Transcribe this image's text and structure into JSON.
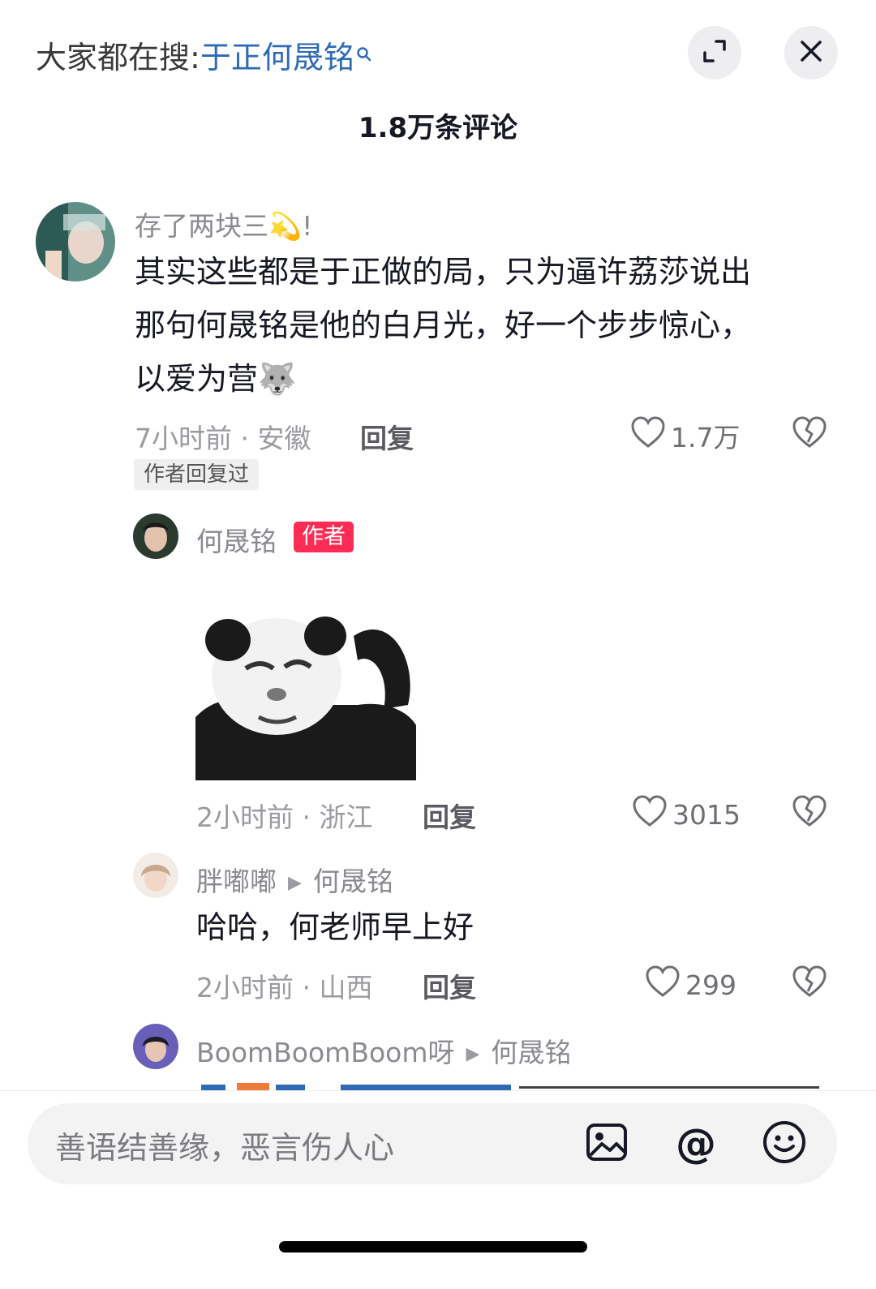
{
  "header": {
    "search_prefix": "大家都在搜:",
    "search_term": "于正何晟铭",
    "comment_count": "1.8万条评论"
  },
  "comments": [
    {
      "username": "存了两块三💫!",
      "text_lines": [
        "其实这些都是于正做的局，只为逼许荔莎说出",
        "那句何晟铭是他的白月光，好一个步步惊心，",
        "以爱为营🐺"
      ],
      "meta": "7小时前 · 安徽",
      "reply_label": "回复",
      "likes": "1.7万",
      "author_replied": "作者回复过"
    },
    {
      "username": "何晟铭",
      "badge": "作者",
      "meta": "2小时前 · 浙江",
      "reply_label": "回复",
      "likes": "3015"
    },
    {
      "username": "胖嘟嘟",
      "reply_to": "何晟铭",
      "text": "哈哈，何老师早上好",
      "meta": "2小时前 · 山西",
      "reply_label": "回复",
      "likes": "299"
    },
    {
      "username": "BoomBoomBoom呀",
      "reply_to": "何晟铭"
    }
  ],
  "input": {
    "placeholder": "善语结善缘，恶言伤人心"
  },
  "colors": {
    "search_term": "#2f6bb5",
    "author_badge": "#fe2c55",
    "text": "#161823",
    "muted": "#9a9aa0"
  }
}
